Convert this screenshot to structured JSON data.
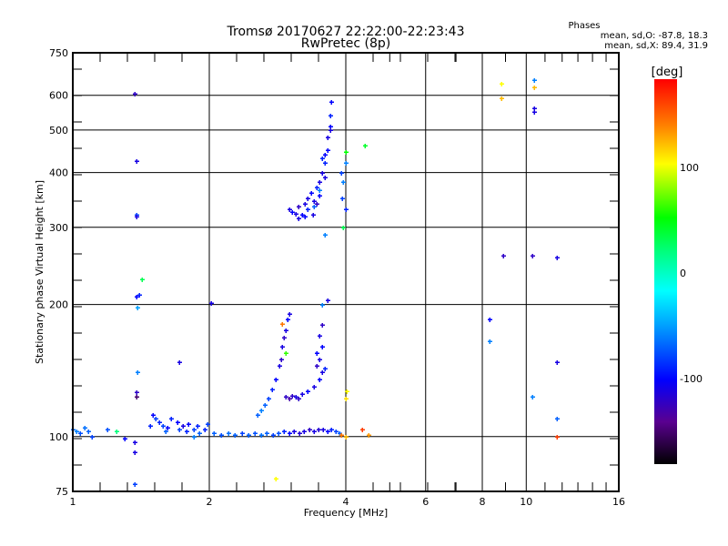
{
  "chart_data": {
    "type": "scatter",
    "title": "Tromsø 20170627 22:22:00-22:23:43",
    "subtitle": "RwPretec (8p)",
    "xlabel": "Frequency [MHz]",
    "ylabel": "Stationary phase Virtual Height [km]",
    "xscale": "log",
    "yscale": "log",
    "xlim": [
      1,
      16
    ],
    "ylim": [
      75,
      750
    ],
    "xticks": [
      "1",
      "2",
      "4",
      "6",
      "8",
      "10",
      "16"
    ],
    "yticks": [
      "75",
      "100",
      "200",
      "300",
      "400",
      "500",
      "600",
      "750"
    ],
    "grid": true,
    "stats": {
      "title": "Phases",
      "o_line": "mean, sd,O:  -87.8, 18.3",
      "x_line": "mean, sd,X:  89.4, 31.9"
    },
    "colorbar": {
      "label": "[deg]",
      "range": [
        -180,
        180
      ],
      "ticks": [
        "100",
        "0",
        "-100"
      ]
    },
    "point_format": [
      "frequency_MHz",
      "height_km",
      "phase_deg"
    ],
    "points": [
      [
        1.0,
        104,
        -70
      ],
      [
        1.02,
        103,
        -60
      ],
      [
        1.04,
        102,
        -75
      ],
      [
        1.06,
        105,
        -65
      ],
      [
        1.08,
        103,
        -70
      ],
      [
        1.1,
        100,
        -80
      ],
      [
        1.19,
        104,
        -75
      ],
      [
        1.25,
        103,
        20
      ],
      [
        1.3,
        99,
        -100
      ],
      [
        1.37,
        97,
        -110
      ],
      [
        1.37,
        92,
        -110
      ],
      [
        1.37,
        78,
        -80
      ],
      [
        1.38,
        126,
        -120
      ],
      [
        1.38,
        123,
        -150
      ],
      [
        1.39,
        140,
        -60
      ],
      [
        1.38,
        208,
        -100
      ],
      [
        1.4,
        210,
        -90
      ],
      [
        1.39,
        197,
        -50
      ],
      [
        1.42,
        228,
        30
      ],
      [
        1.38,
        320,
        -80
      ],
      [
        1.38,
        317,
        -110
      ],
      [
        1.38,
        425,
        -110
      ],
      [
        1.37,
        605,
        -120
      ],
      [
        1.48,
        106,
        -90
      ],
      [
        1.5,
        112,
        -100
      ],
      [
        1.52,
        110,
        -80
      ],
      [
        1.55,
        108,
        -90
      ],
      [
        1.58,
        106,
        -80
      ],
      [
        1.6,
        103,
        -70
      ],
      [
        1.62,
        105,
        -100
      ],
      [
        1.65,
        110,
        -90
      ],
      [
        1.7,
        108,
        -100
      ],
      [
        1.72,
        104,
        -80
      ],
      [
        1.75,
        106,
        -110
      ],
      [
        1.78,
        103,
        -90
      ],
      [
        1.8,
        107,
        -100
      ],
      [
        1.85,
        104,
        -80
      ],
      [
        1.88,
        106,
        -90
      ],
      [
        1.9,
        102,
        -70
      ],
      [
        1.95,
        104,
        -90
      ],
      [
        1.98,
        107,
        -80
      ],
      [
        1.72,
        148,
        -110
      ],
      [
        1.85,
        100,
        -60
      ],
      [
        2.02,
        202,
        -110
      ],
      [
        2.05,
        102,
        -70
      ],
      [
        2.12,
        101,
        -75
      ],
      [
        2.2,
        102,
        -65
      ],
      [
        2.28,
        101,
        -70
      ],
      [
        2.36,
        102,
        -80
      ],
      [
        2.44,
        101,
        -70
      ],
      [
        2.52,
        102,
        -75
      ],
      [
        2.6,
        101,
        -65
      ],
      [
        2.68,
        102,
        -70
      ],
      [
        2.76,
        101,
        -80
      ],
      [
        2.84,
        102,
        -75
      ],
      [
        2.92,
        103,
        -90
      ],
      [
        3.0,
        102,
        -100
      ],
      [
        3.08,
        103,
        -110
      ],
      [
        3.16,
        102,
        -115
      ],
      [
        3.24,
        103,
        -110
      ],
      [
        3.32,
        104,
        -120
      ],
      [
        3.4,
        103,
        -110
      ],
      [
        3.48,
        104,
        -115
      ],
      [
        3.56,
        104,
        -110
      ],
      [
        3.64,
        103,
        -100
      ],
      [
        3.72,
        104,
        -90
      ],
      [
        3.8,
        103,
        -80
      ],
      [
        3.88,
        102,
        -70
      ],
      [
        2.55,
        112,
        -70
      ],
      [
        2.6,
        115,
        -60
      ],
      [
        2.65,
        118,
        -70
      ],
      [
        2.7,
        122,
        -80
      ],
      [
        2.75,
        128,
        -90
      ],
      [
        2.8,
        135,
        -100
      ],
      [
        2.85,
        145,
        -110
      ],
      [
        2.88,
        150,
        -120
      ],
      [
        2.9,
        160,
        -110
      ],
      [
        2.92,
        168,
        -120
      ],
      [
        2.95,
        175,
        -110
      ],
      [
        2.97,
        185,
        -100
      ],
      [
        3.0,
        190,
        -110
      ],
      [
        2.9,
        181,
        140
      ],
      [
        2.95,
        155,
        60
      ],
      [
        2.95,
        123,
        -120
      ],
      [
        3.0,
        122,
        -130
      ],
      [
        3.05,
        124,
        -120
      ],
      [
        3.1,
        123,
        -110
      ],
      [
        3.15,
        122,
        -120
      ],
      [
        3.2,
        125,
        -110
      ],
      [
        3.3,
        127,
        -100
      ],
      [
        3.4,
        130,
        -110
      ],
      [
        3.5,
        135,
        -100
      ],
      [
        3.55,
        140,
        -110
      ],
      [
        3.45,
        145,
        -120
      ],
      [
        3.5,
        150,
        -110
      ],
      [
        3.55,
        160,
        -100
      ],
      [
        3.5,
        170,
        -110
      ],
      [
        3.55,
        180,
        -120
      ],
      [
        3.45,
        155,
        -100
      ],
      [
        3.6,
        143,
        -90
      ],
      [
        3.0,
        330,
        -110
      ],
      [
        3.05,
        325,
        -100
      ],
      [
        3.1,
        322,
        -110
      ],
      [
        3.15,
        335,
        -120
      ],
      [
        3.2,
        320,
        -100
      ],
      [
        3.25,
        340,
        -110
      ],
      [
        3.3,
        330,
        -90
      ],
      [
        3.3,
        350,
        -110
      ],
      [
        3.35,
        360,
        -100
      ],
      [
        3.4,
        345,
        -110
      ],
      [
        3.45,
        370,
        -90
      ],
      [
        3.5,
        380,
        -110
      ],
      [
        3.5,
        355,
        -100
      ],
      [
        3.55,
        400,
        -110
      ],
      [
        3.6,
        420,
        -90
      ],
      [
        3.6,
        390,
        -110
      ],
      [
        3.65,
        450,
        -100
      ],
      [
        3.65,
        480,
        -110
      ],
      [
        3.7,
        510,
        -100
      ],
      [
        3.7,
        540,
        -90
      ],
      [
        3.72,
        580,
        -100
      ],
      [
        3.7,
        500,
        -110
      ],
      [
        3.6,
        440,
        -100
      ],
      [
        3.55,
        430,
        -90
      ],
      [
        3.45,
        340,
        -120
      ],
      [
        3.38,
        320,
        -110
      ],
      [
        3.25,
        318,
        -100
      ],
      [
        3.15,
        315,
        -110
      ],
      [
        3.4,
        335,
        -70
      ],
      [
        3.5,
        365,
        -60
      ],
      [
        3.9,
        400,
        -80
      ],
      [
        3.95,
        380,
        -60
      ],
      [
        3.92,
        350,
        -80
      ],
      [
        4.0,
        330,
        -90
      ],
      [
        3.95,
        300,
        30
      ],
      [
        4.0,
        420,
        -60
      ],
      [
        4.0,
        445,
        50
      ],
      [
        4.4,
        460,
        40
      ],
      [
        8.3,
        185,
        -100
      ],
      [
        8.3,
        165,
        -60
      ],
      [
        8.9,
        258,
        -120
      ],
      [
        8.8,
        637,
        100
      ],
      [
        8.8,
        590,
        120
      ],
      [
        10.4,
        560,
        -110
      ],
      [
        10.4,
        550,
        -110
      ],
      [
        10.4,
        650,
        -60
      ],
      [
        10.4,
        625,
        120
      ],
      [
        10.3,
        258,
        -120
      ],
      [
        11.7,
        256,
        -110
      ],
      [
        11.7,
        148,
        -110
      ],
      [
        11.7,
        110,
        -70
      ],
      [
        11.7,
        100,
        160
      ],
      [
        10.3,
        123,
        -60
      ],
      [
        4.0,
        100,
        120
      ],
      [
        3.9,
        101,
        140
      ],
      [
        4.35,
        104,
        160
      ],
      [
        4.5,
        101,
        130
      ],
      [
        4.02,
        127,
        100
      ],
      [
        4.0,
        122,
        110
      ],
      [
        2.8,
        80,
        100
      ],
      [
        3.6,
        288,
        -60
      ],
      [
        3.55,
        200,
        -60
      ],
      [
        3.65,
        205,
        -110
      ]
    ]
  }
}
